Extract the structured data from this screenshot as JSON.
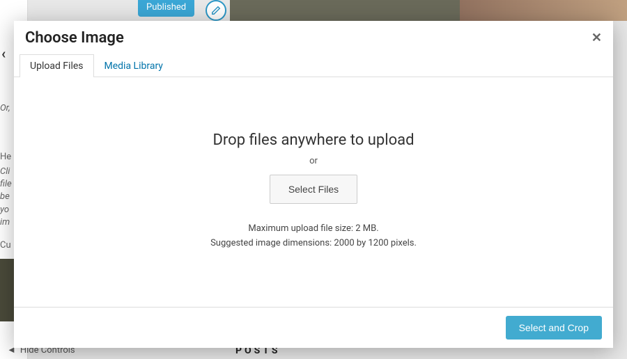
{
  "background": {
    "published_label": "Published",
    "or_text": "Or,",
    "header_label": "He",
    "description_lines": "Cli\nfile\nbe\nyo\nim",
    "current_label": "Cu",
    "hide_controls": "Hide Controls",
    "posts_label": "POSTS"
  },
  "modal": {
    "title": "Choose Image",
    "tabs": [
      {
        "label": "Upload Files",
        "active": true
      },
      {
        "label": "Media Library",
        "active": false
      }
    ],
    "upload": {
      "drop_heading": "Drop files anywhere to upload",
      "or_text": "or",
      "select_button": "Select Files",
      "max_size_text": "Maximum upload file size: 2 MB.",
      "suggested_dimensions_text": "Suggested image dimensions: 2000 by 1200 pixels."
    },
    "footer": {
      "primary_button": "Select and Crop"
    }
  }
}
